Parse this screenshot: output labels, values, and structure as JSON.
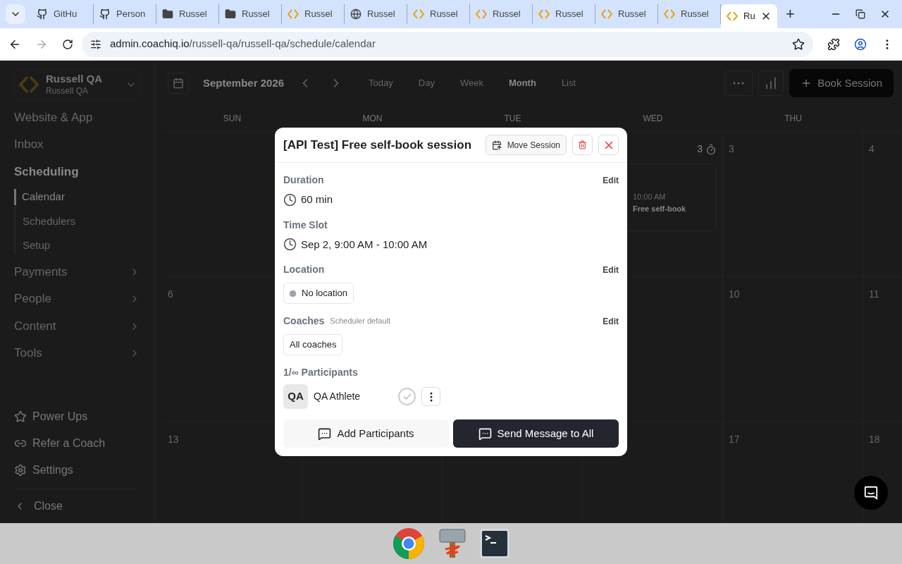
{
  "browser": {
    "tabs": [
      {
        "label": "GitHu",
        "kind": "github",
        "selected": false
      },
      {
        "label": "Person",
        "kind": "github",
        "selected": false
      },
      {
        "label": "Russel",
        "kind": "folder",
        "selected": false
      },
      {
        "label": "Russel",
        "kind": "folder",
        "selected": false
      },
      {
        "label": "Russel",
        "kind": "brackets",
        "selected": false
      },
      {
        "label": "Russel",
        "kind": "globe",
        "selected": false
      },
      {
        "label": "Russel",
        "kind": "brackets",
        "selected": false
      },
      {
        "label": "Russel",
        "kind": "brackets",
        "selected": false
      },
      {
        "label": "Russel",
        "kind": "brackets",
        "selected": false
      },
      {
        "label": "Russel",
        "kind": "brackets",
        "selected": false
      },
      {
        "label": "Russel",
        "kind": "brackets",
        "selected": false
      },
      {
        "label": "Ru",
        "kind": "brackets",
        "selected": true
      }
    ],
    "new_tab": "+",
    "url_host": "admin.coachiq.io",
    "url_path": "/russell-qa/russell-qa/schedule/calendar"
  },
  "sidebar": {
    "org_name": "Russell QA",
    "org_sub": "Russell QA",
    "items": [
      {
        "label": "Website & App",
        "kind": "link"
      },
      {
        "label": "Inbox",
        "kind": "link"
      },
      {
        "label": "Scheduling",
        "kind": "group",
        "expanded": true,
        "children": [
          {
            "label": "Calendar",
            "selected": true
          },
          {
            "label": "Schedulers",
            "selected": false
          },
          {
            "label": "Setup",
            "selected": false
          }
        ]
      },
      {
        "label": "Payments",
        "kind": "group",
        "expanded": false
      },
      {
        "label": "People",
        "kind": "group",
        "expanded": false
      },
      {
        "label": "Content",
        "kind": "group",
        "expanded": false
      },
      {
        "label": "Tools",
        "kind": "group",
        "expanded": false
      }
    ],
    "footer": [
      {
        "label": "Power Ups",
        "kind": "star"
      },
      {
        "label": "Refer a Coach",
        "kind": "link"
      },
      {
        "label": "Settings",
        "kind": "gear"
      }
    ],
    "close": "Close"
  },
  "toolbar": {
    "month": "September 2026",
    "views": [
      {
        "label": "Today",
        "selected": false
      },
      {
        "label": "Day",
        "selected": false
      },
      {
        "label": "Week",
        "selected": false
      },
      {
        "label": "Month",
        "selected": true
      },
      {
        "label": "List",
        "selected": false
      }
    ],
    "book_button": "Book Session"
  },
  "calendar": {
    "weekdays": [
      "SUN",
      "MON",
      "TUE",
      "WED",
      "THU"
    ],
    "weeks": [
      {
        "cells": [
          {},
          {},
          {},
          {
            "count": "3",
            "event": {
              "time": "10:00 AM",
              "title": "Free self-book"
            }
          },
          {
            "day": "3"
          },
          {
            "day": "4"
          }
        ]
      },
      {
        "cells": [
          {
            "day": "6"
          },
          {},
          {},
          {},
          {
            "day": "10"
          },
          {
            "day": "11"
          }
        ]
      },
      {
        "cells": [
          {
            "day": "13"
          },
          {},
          {},
          {},
          {
            "day": "17"
          },
          {
            "day": "18"
          }
        ]
      }
    ]
  },
  "modal": {
    "title": "[API Test] Free self-book session",
    "move_button": "Move Session",
    "sections": [
      {
        "kind": "value",
        "label": "Duration",
        "edit": "Edit",
        "value": "60 min"
      },
      {
        "kind": "value",
        "label": "Time Slot",
        "value": "Sep 2, 9:00 AM - 10:00 AM"
      },
      {
        "kind": "chip",
        "label": "Location",
        "edit": "Edit",
        "chip": "No location",
        "color": "#9ca3af"
      },
      {
        "kind": "chip",
        "label": "Coaches",
        "note": "Scheduler default",
        "edit": "Edit",
        "chip": "All coaches"
      }
    ],
    "participants_label": "1/∞ Participants",
    "participants": [
      {
        "initials": "QA",
        "name": "QA Athlete",
        "checked": false
      }
    ],
    "add_button": "Add Participants",
    "message_button": "Send Message to All"
  }
}
